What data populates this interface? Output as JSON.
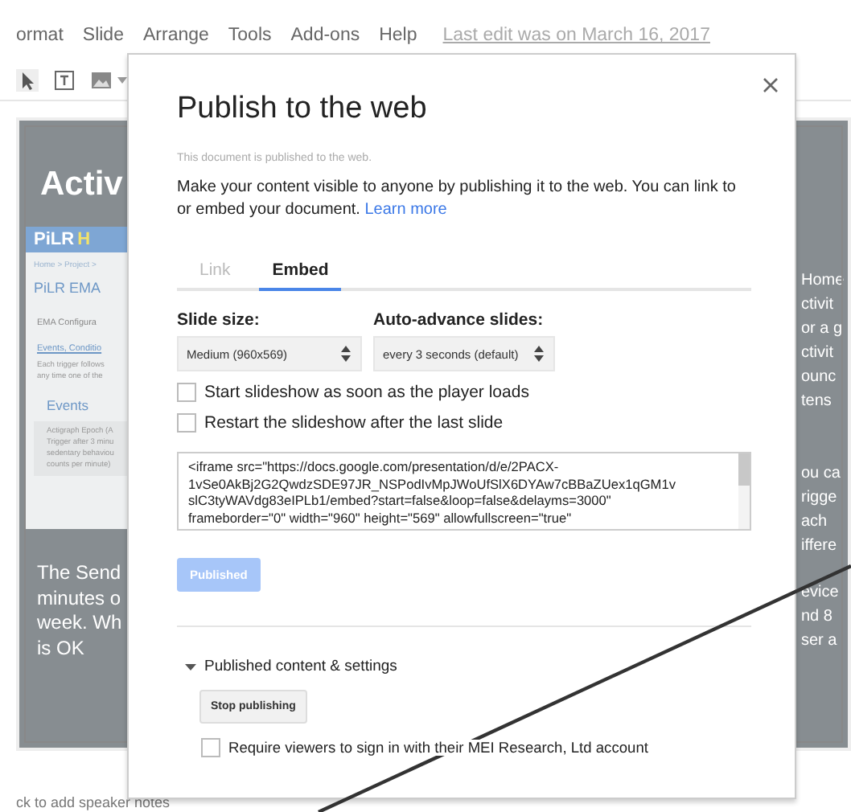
{
  "menu_bar": {
    "items": [
      "ormat",
      "Slide",
      "Arrange",
      "Tools",
      "Add-ons",
      "Help"
    ],
    "last_edit": "Last edit was on March 16, 2017"
  },
  "slide": {
    "title": "Activ",
    "app_panel": {
      "brand": "PiLR",
      "brand_suffix": "H",
      "breadcrumb": "Home > Project >",
      "heading": "PiLR EMA",
      "section": "EMA Configura",
      "tab": "Events, Conditio",
      "description": [
        "Each trigger follows",
        "any time one of the"
      ],
      "events_heading": "Events",
      "event_lines": [
        "Actigraph Epoch (A",
        "Trigger after 3 minu",
        "sedentary behaviou",
        "counts per minute)"
      ]
    },
    "bottom_text": [
      "The Send",
      "minutes o",
      "week.  Wh",
      "is OK"
    ],
    "right_text": [
      [
        "Home",
        "ctivit",
        "or a g",
        "ctivit",
        "ounc",
        "tens"
      ],
      [
        "ou ca",
        "rigge",
        "ach",
        "iffere"
      ],
      [
        "evice",
        "nd 8",
        "ser a"
      ]
    ]
  },
  "dialog": {
    "title": "Publish to the web",
    "status": "This document is published to the web.",
    "description": "Make your content visible to anyone by publishing it to the web. You can link to or embed your document.",
    "link": "Learn more",
    "tabs": [
      {
        "label": "Link",
        "selected": false
      },
      {
        "label": "Embed",
        "selected": true
      }
    ],
    "settings": [
      {
        "label": "Slide size:",
        "value": "Medium (960x569)"
      },
      {
        "label": "Auto-advance slides:",
        "value": "every 3 seconds (default)"
      }
    ],
    "options": [
      {
        "label": "Start slideshow as soon as the player loads",
        "checked": false
      },
      {
        "label": "Restart the slideshow after the last slide",
        "checked": false
      }
    ],
    "embed_code_lines": [
      "<iframe src=\"https://docs.google.com/presentation/d/e/2PACX-",
      "1vSe0AkBj2G2QwdzSDE97JR_NSPodIvMpJWoUfSlX6DYAw7cBBaZUex1qGM1v",
      "slC3tyWAVdg83eIPLb1/embed?start=false&loop=false&delayms=3000\"",
      "frameborder=\"0\" width=\"960\" height=\"569\" allowfullscreen=\"true\""
    ],
    "publish_button": {
      "label": "Published",
      "disabled": true
    },
    "section": {
      "label": "Published content & settings",
      "expanded": true
    },
    "stop_button": "Stop publishing",
    "require_signin": {
      "label": "Require viewers to sign in with their MEI Research, Ltd account",
      "checked": false
    }
  },
  "speaker_notes": "ck to add speaker notes"
}
